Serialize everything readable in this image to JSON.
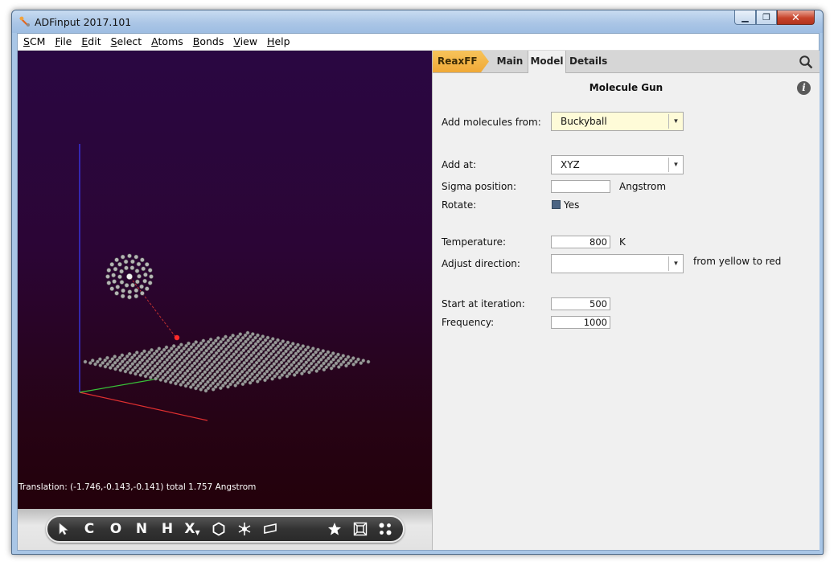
{
  "window": {
    "title": "ADFinput 2017.101"
  },
  "menu": [
    {
      "first": "S",
      "rest": "CM"
    },
    {
      "first": "F",
      "rest": "ile"
    },
    {
      "first": "E",
      "rest": "dit"
    },
    {
      "first": "S",
      "rest": "elect"
    },
    {
      "first": "A",
      "rest": "toms"
    },
    {
      "first": "B",
      "rest": "onds"
    },
    {
      "first": "V",
      "rest": "iew"
    },
    {
      "first": "H",
      "rest": "elp"
    }
  ],
  "viewer": {
    "translation": "Translation: (-1.746,-0.143,-0.141) total  1.757 Angstrom",
    "toolbar": [
      "select-arrow-icon",
      "C",
      "O",
      "N",
      "H",
      "X",
      "hexagon-ring-icon",
      "snowflake-icon",
      "parallelogram-icon",
      "star-icon",
      "cube-frame-icon",
      "molecule-dots-icon"
    ]
  },
  "tabs": {
    "reaxff": "ReaxFF",
    "main": "Main",
    "model": "Model",
    "details": "Details"
  },
  "panel": {
    "title": "Molecule Gun",
    "add_from_label": "Add molecules from:",
    "add_from_value": "Buckyball",
    "add_at_label": "Add at:",
    "add_at_value": "XYZ",
    "sigma_label": "Sigma position:",
    "sigma_value": "",
    "sigma_unit": "Angstrom",
    "rotate_label": "Rotate:",
    "rotate_value": "Yes",
    "temperature_label": "Temperature:",
    "temperature_value": "800",
    "temperature_unit": "K",
    "adjust_label": "Adjust direction:",
    "adjust_value": "",
    "adjust_note": "from yellow to red",
    "start_label": "Start at iteration:",
    "start_value": "500",
    "frequency_label": "Frequency:",
    "frequency_value": "1000"
  },
  "colors": {
    "accent_tab": "#f0a937",
    "viewer_bg": "#2a0742"
  }
}
